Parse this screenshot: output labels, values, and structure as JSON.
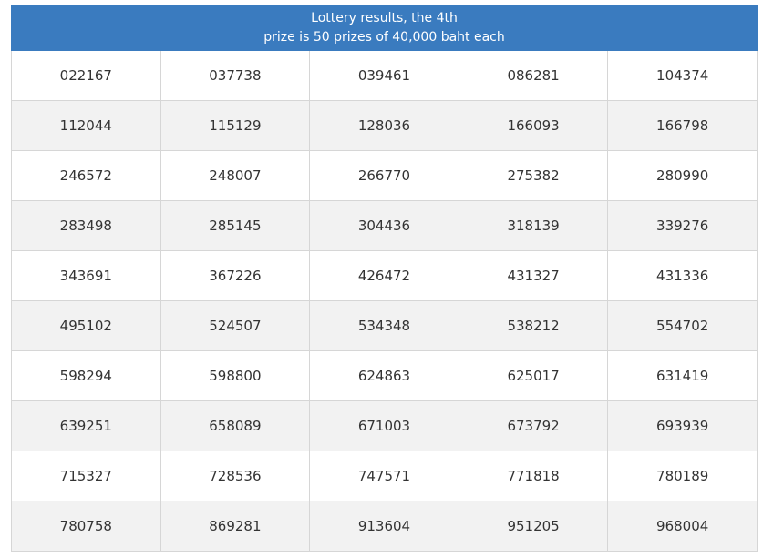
{
  "header": {
    "title_line1": "Lottery results, the 4th",
    "title_line2": "prize is 50 prizes of 40,000 baht each"
  },
  "numbers": [
    [
      "022167",
      "037738",
      "039461",
      "086281",
      "104374"
    ],
    [
      "112044",
      "115129",
      "128036",
      "166093",
      "166798"
    ],
    [
      "246572",
      "248007",
      "266770",
      "275382",
      "280990"
    ],
    [
      "283498",
      "285145",
      "304436",
      "318139",
      "339276"
    ],
    [
      "343691",
      "367226",
      "426472",
      "431327",
      "431336"
    ],
    [
      "495102",
      "524507",
      "534348",
      "538212",
      "554702"
    ],
    [
      "598294",
      "598800",
      "624863",
      "625017",
      "631419"
    ],
    [
      "639251",
      "658089",
      "671003",
      "673792",
      "693939"
    ],
    [
      "715327",
      "728536",
      "747571",
      "771818",
      "780189"
    ],
    [
      "780758",
      "869281",
      "913604",
      "951205",
      "968004"
    ]
  ],
  "colors": {
    "header_bg": "#3a7bbf",
    "header_text": "#ffffff",
    "row_alt_bg": "#f2f2f2",
    "cell_text": "#333333",
    "border": "#d6d6d6"
  }
}
